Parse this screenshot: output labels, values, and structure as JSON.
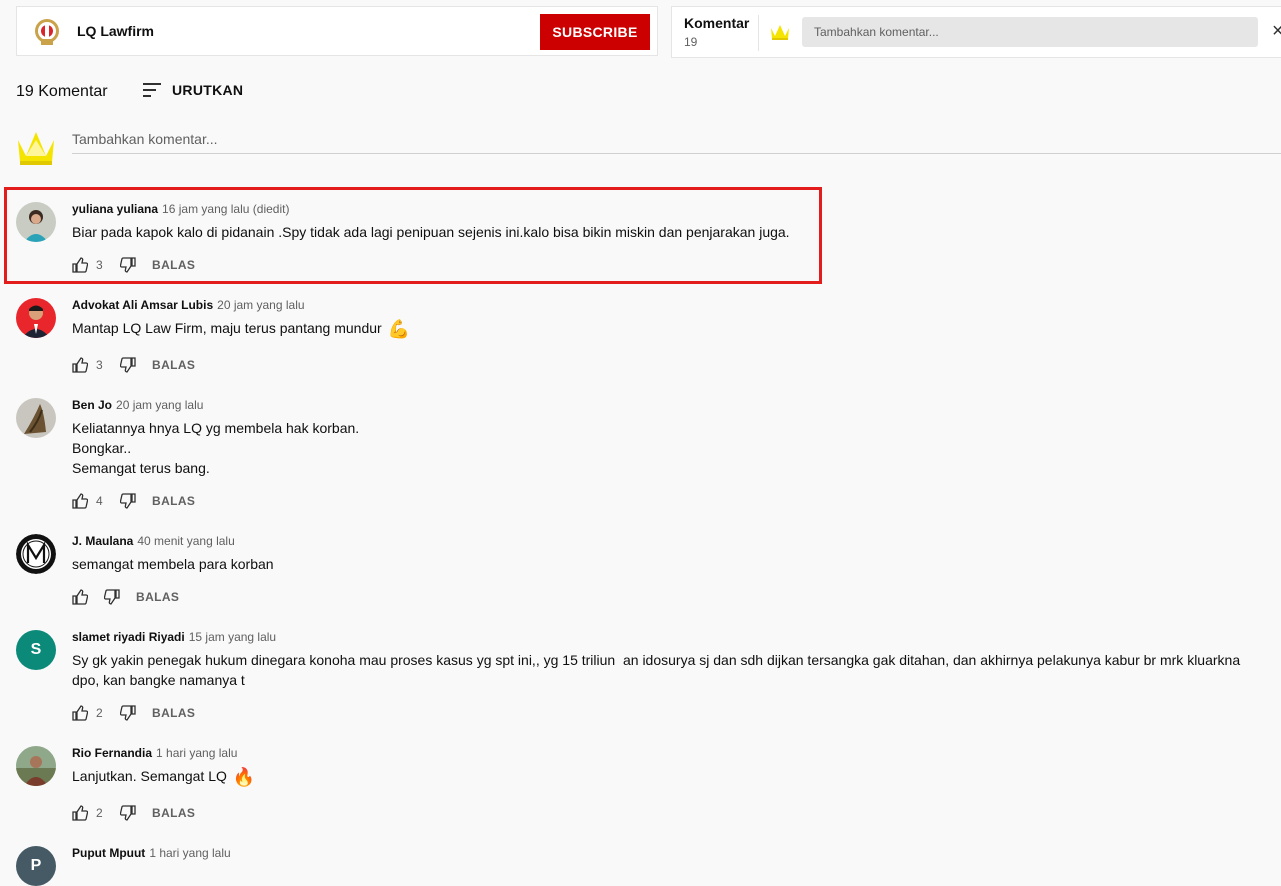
{
  "channel": {
    "name": "LQ Lawfirm",
    "subscribe_label": "SUBSCRIBE"
  },
  "mini_panel": {
    "title": "Komentar",
    "count": "19",
    "placeholder": "Tambahkan komentar...",
    "close_glyph": "×"
  },
  "comments_header": {
    "count_label": "19 Komentar",
    "sort_label": "URUTKAN"
  },
  "add_comment": {
    "placeholder": "Tambahkan komentar..."
  },
  "reply_label": "BALAS",
  "comments": [
    {
      "author": "yuliana yuliana",
      "time": "16 jam yang lalu (diedit)",
      "text": "Biar pada kapok kalo di pidanain .Spy tidak ada lagi penipuan sejenis ini.kalo bisa bikin miskin dan penjarakan juga.",
      "likes": "3",
      "highlighted": true
    },
    {
      "author": "Advokat Ali Amsar Lubis",
      "time": "20 jam yang lalu",
      "text": "Mantap LQ Law Firm, maju terus pantang mundur",
      "emoji": "💪",
      "likes": "3"
    },
    {
      "author": "Ben Jo",
      "time": "20 jam yang lalu",
      "lines": [
        "Keliatannya hnya LQ yg membela hak korban.",
        "Bongkar..",
        "Semangat terus bang."
      ],
      "likes": "4"
    },
    {
      "author": "J. Maulana",
      "time": "40 menit yang lalu",
      "text": "semangat membela para korban",
      "likes": ""
    },
    {
      "author": "slamet riyadi Riyadi",
      "time": "15 jam yang lalu",
      "text": "Sy gk yakin penegak hukum dinegara konoha mau proses kasus yg spt ini,, yg 15 triliun  an idosurya sj dan sdh dijkan tersangka gak ditahan, dan akhirnya pelakunya kabur br mrk kluarkna dpo, kan bangke namanya t",
      "likes": "2",
      "avatar_letter": "S",
      "avatar_color": "#0b8a79"
    },
    {
      "author": "Rio Fernandia",
      "time": "1 hari yang lalu",
      "text": "Lanjutkan. Semangat LQ",
      "emoji": "🔥",
      "likes": "2"
    },
    {
      "author": "Puput Mpuut",
      "time": "1 hari yang lalu",
      "avatar_letter": "P",
      "avatar_color": "#455a64"
    }
  ],
  "colors": {
    "subscribe": "#cc0000",
    "highlight": "#e31c1c",
    "crown": "#f5e400"
  }
}
